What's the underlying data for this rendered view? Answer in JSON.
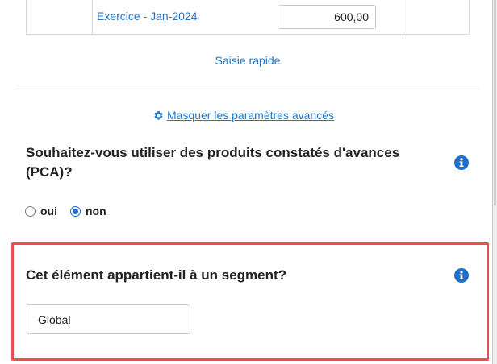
{
  "period_row": {
    "label": "Exercice - Jan-2024",
    "amount": "600,00"
  },
  "quick_entry_link": "Saisie rapide",
  "advanced_toggle": {
    "label": "Masquer les paramètres avancés",
    "icon": "gear-icon"
  },
  "pca_question": {
    "title": "Souhaitez-vous utiliser des produits constatés d'avances (PCA)?",
    "options": [
      {
        "label": "oui",
        "selected": false
      },
      {
        "label": "non",
        "selected": true
      }
    ],
    "icon": "info-icon"
  },
  "segment_question": {
    "title": "Cet élément appartient-il à un segment?",
    "value": "Global",
    "icon": "info-icon"
  },
  "colors": {
    "link": "#1f78c8",
    "highlight": "#e8524a",
    "radio_selected": "#1f6fd0",
    "text": "#222222"
  }
}
